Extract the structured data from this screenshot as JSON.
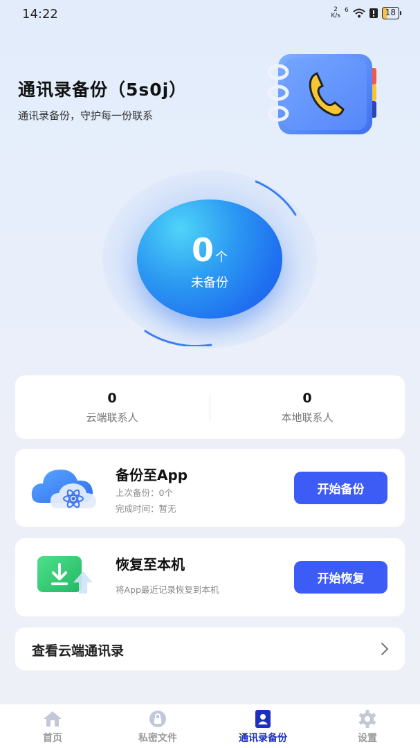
{
  "status_bar": {
    "time": "14:22",
    "net_speed_top": "2",
    "net_speed_bottom": "K/s",
    "signal_label": "6",
    "battery": "18"
  },
  "header": {
    "title": "通讯录备份（5s0j）",
    "subtitle": "通讯录备份，守护每一份联系"
  },
  "counter": {
    "value": "0",
    "unit": "个",
    "label": "未备份"
  },
  "stats": {
    "cloud_value": "0",
    "cloud_label": "云端联系人",
    "local_value": "0",
    "local_label": "本地联系人"
  },
  "backup": {
    "title": "备份至App",
    "last_backup": "上次备份：0个",
    "finish_time": "完成时间：暂无",
    "button": "开始备份"
  },
  "restore": {
    "title": "恢复至本机",
    "description": "将App最近记录恢复到本机",
    "button": "开始恢复"
  },
  "cloud_link": {
    "label": "查看云端通讯录"
  },
  "nav": {
    "items": [
      {
        "label": "首页",
        "icon": "home-icon"
      },
      {
        "label": "私密文件",
        "icon": "lock-icon"
      },
      {
        "label": "通讯录备份",
        "icon": "contacts-icon"
      },
      {
        "label": "设置",
        "icon": "gear-icon"
      }
    ],
    "active_index": 2
  },
  "colors": {
    "accent": "#3d5cf5",
    "active_nav": "#1c2fbf",
    "inactive_nav": "#c3c8d8"
  }
}
